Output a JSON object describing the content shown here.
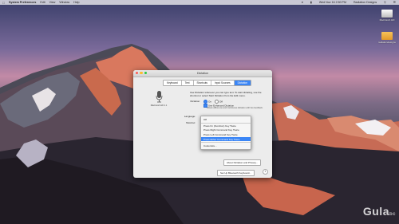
{
  "menubar": {
    "apple_icon": "apple-logo-icon",
    "app_name": "System Preferences",
    "items": [
      "Edit",
      "View",
      "Window",
      "Help"
    ],
    "datetime": "Wed Nov 16  2:50 PM",
    "user": "Radiation Designs"
  },
  "desktop": {
    "icons": [
      {
        "label": "Macintosh HD",
        "type": "drive"
      },
      {
        "label": "radiationdesigns",
        "type": "folder"
      }
    ]
  },
  "window": {
    "title": "Dictation",
    "tabs": [
      "Keyboard",
      "Text",
      "Shortcuts",
      "Input Sources",
      "Dictation"
    ],
    "active_tab": "Dictation",
    "mic_label": "Macintosh HD 1.1",
    "intro": "Use Dictation wherever you can type text. To start dictating, use the shortcut or select Start Dictation from the Edit menu.",
    "dictation_label": "Dictation:",
    "dictation_on": "On",
    "dictation_off": "Off",
    "enhanced_label": "Use Enhanced Dictation",
    "enhanced_desc": "Allows offline use and continuous dictation with live feedback.",
    "language_label": "Language:",
    "shortcut_label": "Shortcut:",
    "shortcut_selected": "Off",
    "shortcut_menu": [
      "Off",
      "Press Fn (Function) Key Twice",
      "Press Right Command Key Twice",
      "Press Left Command Key Twice",
      "Press Either Command Key Twice",
      "Customize..."
    ],
    "shortcut_menu_selected": 4,
    "about_button": "About Dictation and Privacy...",
    "bluetooth_button": "Set Up Bluetooth Keyboard...",
    "help_button": "?"
  },
  "watermark": {
    "text": "Gula",
    "suffix": "bc"
  }
}
